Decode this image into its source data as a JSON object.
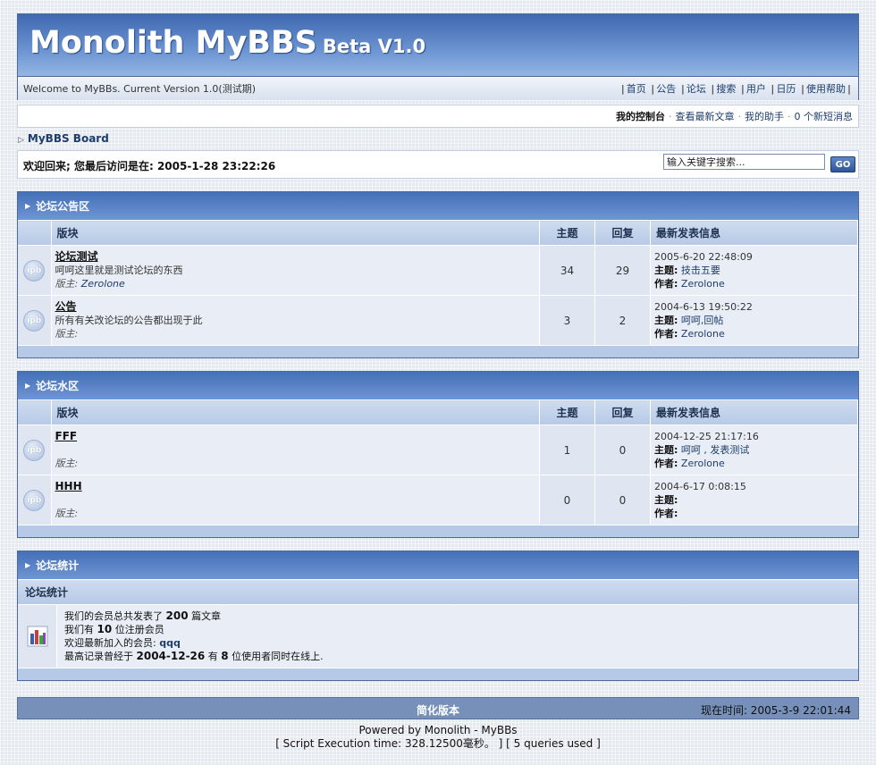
{
  "header": {
    "logo_main": "Monolith MyBBS",
    "logo_sub": "Beta V1.0",
    "welcome_version": "Welcome to MyBBs. Current Version 1.0(测试期)",
    "nav": [
      "首页",
      "公告",
      "论坛",
      "搜索",
      "用户",
      "日历",
      "使用帮助"
    ]
  },
  "userbar": {
    "control_panel": "我的控制台",
    "latest_posts": "查看最新文章",
    "assistant": "我的助手",
    "messages": "0 个新短消息"
  },
  "breadcrumb": "MyBBS Board",
  "welcome": {
    "last_visit": "欢迎回来; 您最后访问是在: 2005-1-28 23:22:26",
    "search_placeholder": "输入关键字搜索...",
    "go": "GO"
  },
  "table_headers": {
    "forum": "版块",
    "topics": "主题",
    "replies": "回复",
    "last_post": "最新发表信息"
  },
  "labels": {
    "moderator": "版主:",
    "topic": "主题:",
    "author": "作者:",
    "icon_text": "ipb"
  },
  "categories": [
    {
      "title": "论坛公告区",
      "forums": [
        {
          "name": "论坛测试",
          "desc": "呵呵这里就是测试论坛的东西",
          "moderator": "Zerolone",
          "topics": "34",
          "replies": "29",
          "last_time": "2005-6-20 22:48:09",
          "last_topic": "技击五要",
          "last_author": "Zerolone"
        },
        {
          "name": "公告",
          "desc": "所有有关改论坛的公告都出现于此",
          "moderator": "",
          "topics": "3",
          "replies": "2",
          "last_time": "2004-6-13 19:50:22",
          "last_topic": "呵呵,回帖",
          "last_author": "Zerolone"
        }
      ]
    },
    {
      "title": "论坛水区",
      "forums": [
        {
          "name": "FFF",
          "desc": "",
          "moderator": "",
          "topics": "1",
          "replies": "0",
          "last_time": "2004-12-25 21:17:16",
          "last_topic": "呵呵 , 发表测试",
          "last_author": "Zerolone"
        },
        {
          "name": "HHH",
          "desc": "",
          "moderator": "",
          "topics": "0",
          "replies": "0",
          "last_time": "2004-6-17 0:08:15",
          "last_topic": "",
          "last_author": ""
        }
      ]
    }
  ],
  "stats": {
    "title": "论坛统计",
    "subtitle": "论坛统计",
    "line1_pre": "我们的会员总共发表了",
    "total_posts": "200",
    "line1_post": "篇文章",
    "line2_pre": "我们有",
    "members": "10",
    "line2_post": "位注册会员",
    "line3_pre": "欢迎最新加入的会员:",
    "newest_member": "qqq",
    "line4_pre": "最高记录曾经于",
    "record_date": "2004-12-26",
    "line4_mid": "有",
    "record_count": "8",
    "line4_post": "位使用者同时在线上."
  },
  "footer": {
    "lofi": "简化版本",
    "server_time": "现在时间: 2005-3-9 22:01:44",
    "powered": "Powered by Monolith - MyBBs",
    "exec": "[ Script Execution time: 328.12500毫秒。 ] [ 5 queries used ]"
  }
}
